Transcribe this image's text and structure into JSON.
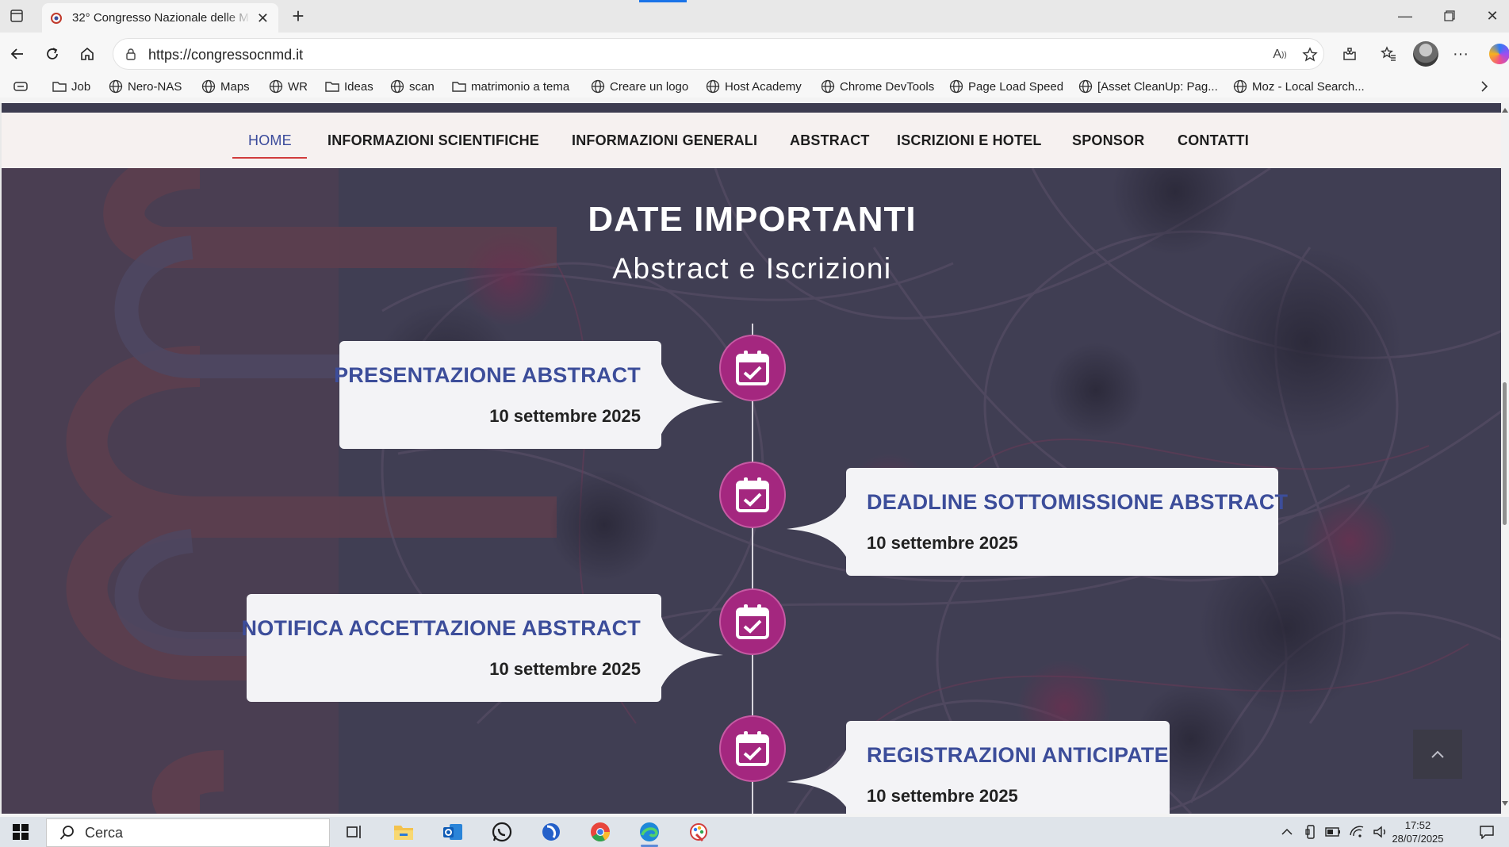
{
  "browser": {
    "tab_title": "32° Congresso Nazionale delle M",
    "url": "https://congressocnmd.it",
    "bookmarks": [
      {
        "label": "",
        "icon": "reading-list-icon"
      },
      {
        "label": "Job",
        "icon": "folder-icon"
      },
      {
        "label": "Nero-NAS",
        "icon": "globe-icon"
      },
      {
        "label": "Maps",
        "icon": "globe-icon"
      },
      {
        "label": "WR",
        "icon": "globe-icon"
      },
      {
        "label": "Ideas",
        "icon": "folder-icon"
      },
      {
        "label": "scan",
        "icon": "globe-icon"
      },
      {
        "label": "matrimonio a tema",
        "icon": "folder-icon"
      },
      {
        "label": "Creare un logo",
        "icon": "globe-icon"
      },
      {
        "label": "Host Academy",
        "icon": "globe-icon"
      },
      {
        "label": "Chrome DevTools",
        "icon": "globe-icon"
      },
      {
        "label": "Page Load Speed",
        "icon": "globe-icon"
      },
      {
        "label": "[Asset CleanUp: Pag...",
        "icon": "globe-icon"
      },
      {
        "label": "Moz - Local Search...",
        "icon": "globe-icon"
      }
    ]
  },
  "site": {
    "nav": [
      "HOME",
      "INFORMAZIONI SCIENTIFICHE",
      "INFORMAZIONI GENERALI",
      "ABSTRACT",
      "ISCRIZIONI E HOTEL",
      "SPONSOR",
      "CONTATTI"
    ],
    "active_nav": "HOME",
    "hero": {
      "title": "DATE IMPORTANTI",
      "subtitle": "Abstract e Iscrizioni"
    },
    "timeline": [
      {
        "title": "PRESENTAZIONE ABSTRACT",
        "date": "10 settembre 2025",
        "side": "left"
      },
      {
        "title": "DEADLINE SOTTOMISSIONE ABSTRACT",
        "date": "10 settembre 2025",
        "side": "right"
      },
      {
        "title": "NOTIFICA ACCETTAZIONE ABSTRACT",
        "date": "10 settembre 2025",
        "side": "left"
      },
      {
        "title": "REGISTRAZIONI ANTICIPATE",
        "date": "10 settembre 2025",
        "side": "right"
      }
    ]
  },
  "taskbar": {
    "search_placeholder": "Cerca",
    "time": "17:52",
    "date": "28/07/2025"
  },
  "colors": {
    "accent_blue": "#3c4d9a",
    "timeline_dot": "#a4277f",
    "hero_bg": "#403e53",
    "nav_underline": "#d13c3c"
  }
}
